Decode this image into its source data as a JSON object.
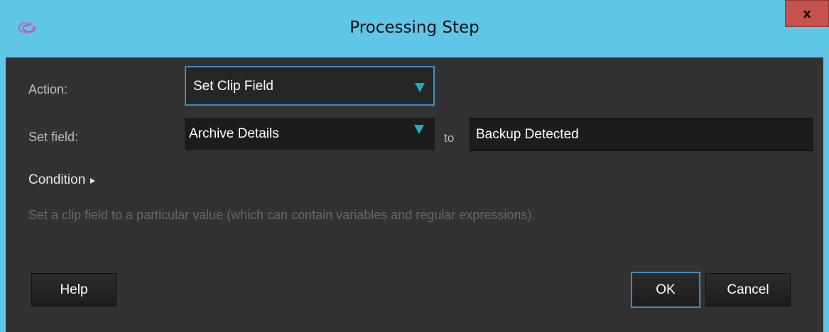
{
  "window": {
    "title": "Processing Step",
    "close_label": "x",
    "app_icon": "dialog-app-icon",
    "colors": {
      "titlebar": "#60c6e8",
      "client": "#323232",
      "close_button": "#c7514c",
      "focus_border": "#3f8dc4",
      "combo_arrow": "#1fa9c2"
    }
  },
  "form": {
    "action_label": "Action:",
    "action_value": "Set Clip Field",
    "set_field_label": "Set field:",
    "field_value": "Archive Details",
    "to_label": "to",
    "target_value": "Backup Detected",
    "condition_label": "Condition"
  },
  "description": "Set a clip field to a particular value (which can contain variables and regular expressions).",
  "buttons": {
    "help": "Help",
    "ok": "OK",
    "cancel": "Cancel"
  }
}
